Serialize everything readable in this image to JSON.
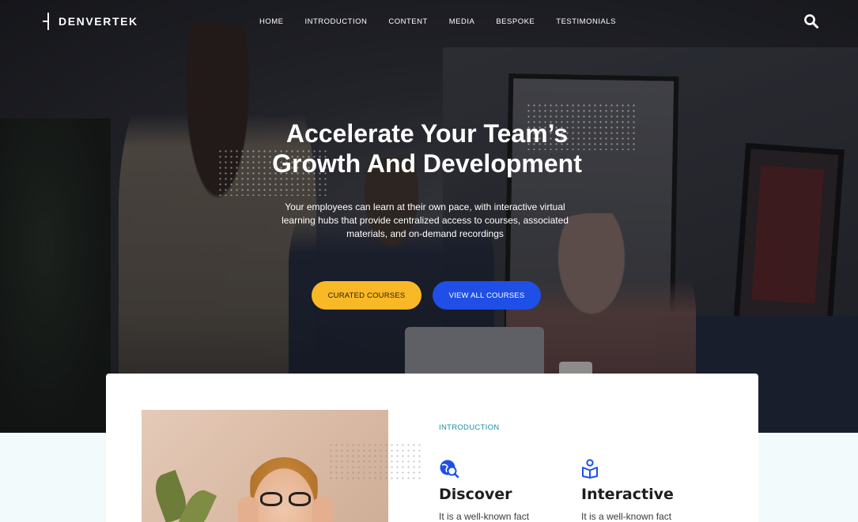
{
  "nav": {
    "logo_text": "DENVERTEK",
    "menu_items": [
      "HOME",
      "INTRODUCTION",
      "CONTENT",
      "MEDIA",
      "BESPOKE",
      "TESTIMONIALS"
    ],
    "search_icon": "search-icon"
  },
  "hero": {
    "title_line1": "Accelerate Your Team’s",
    "title_line2": "Growth And Development",
    "subtitle": "Your employees can learn at their own pace, with interactive virtual learning hubs that provide centralized access to courses, associated materials, and on-demand recordings",
    "buttons": {
      "curated_label": "CURATED COURSES",
      "all_label": "VIEW ALL COURSES"
    }
  },
  "intro": {
    "label": "INTRODUCTION",
    "features": [
      {
        "icon": "globe-search-icon",
        "title": "Discover",
        "text": "It is a well-known fact"
      },
      {
        "icon": "person-book-icon",
        "title": "Interactive",
        "text": "It is a well-known fact"
      }
    ]
  },
  "colors": {
    "accent_yellow": "#f9b826",
    "accent_blue": "#1f4fe6",
    "intro_teal": "#1b8fa3"
  }
}
